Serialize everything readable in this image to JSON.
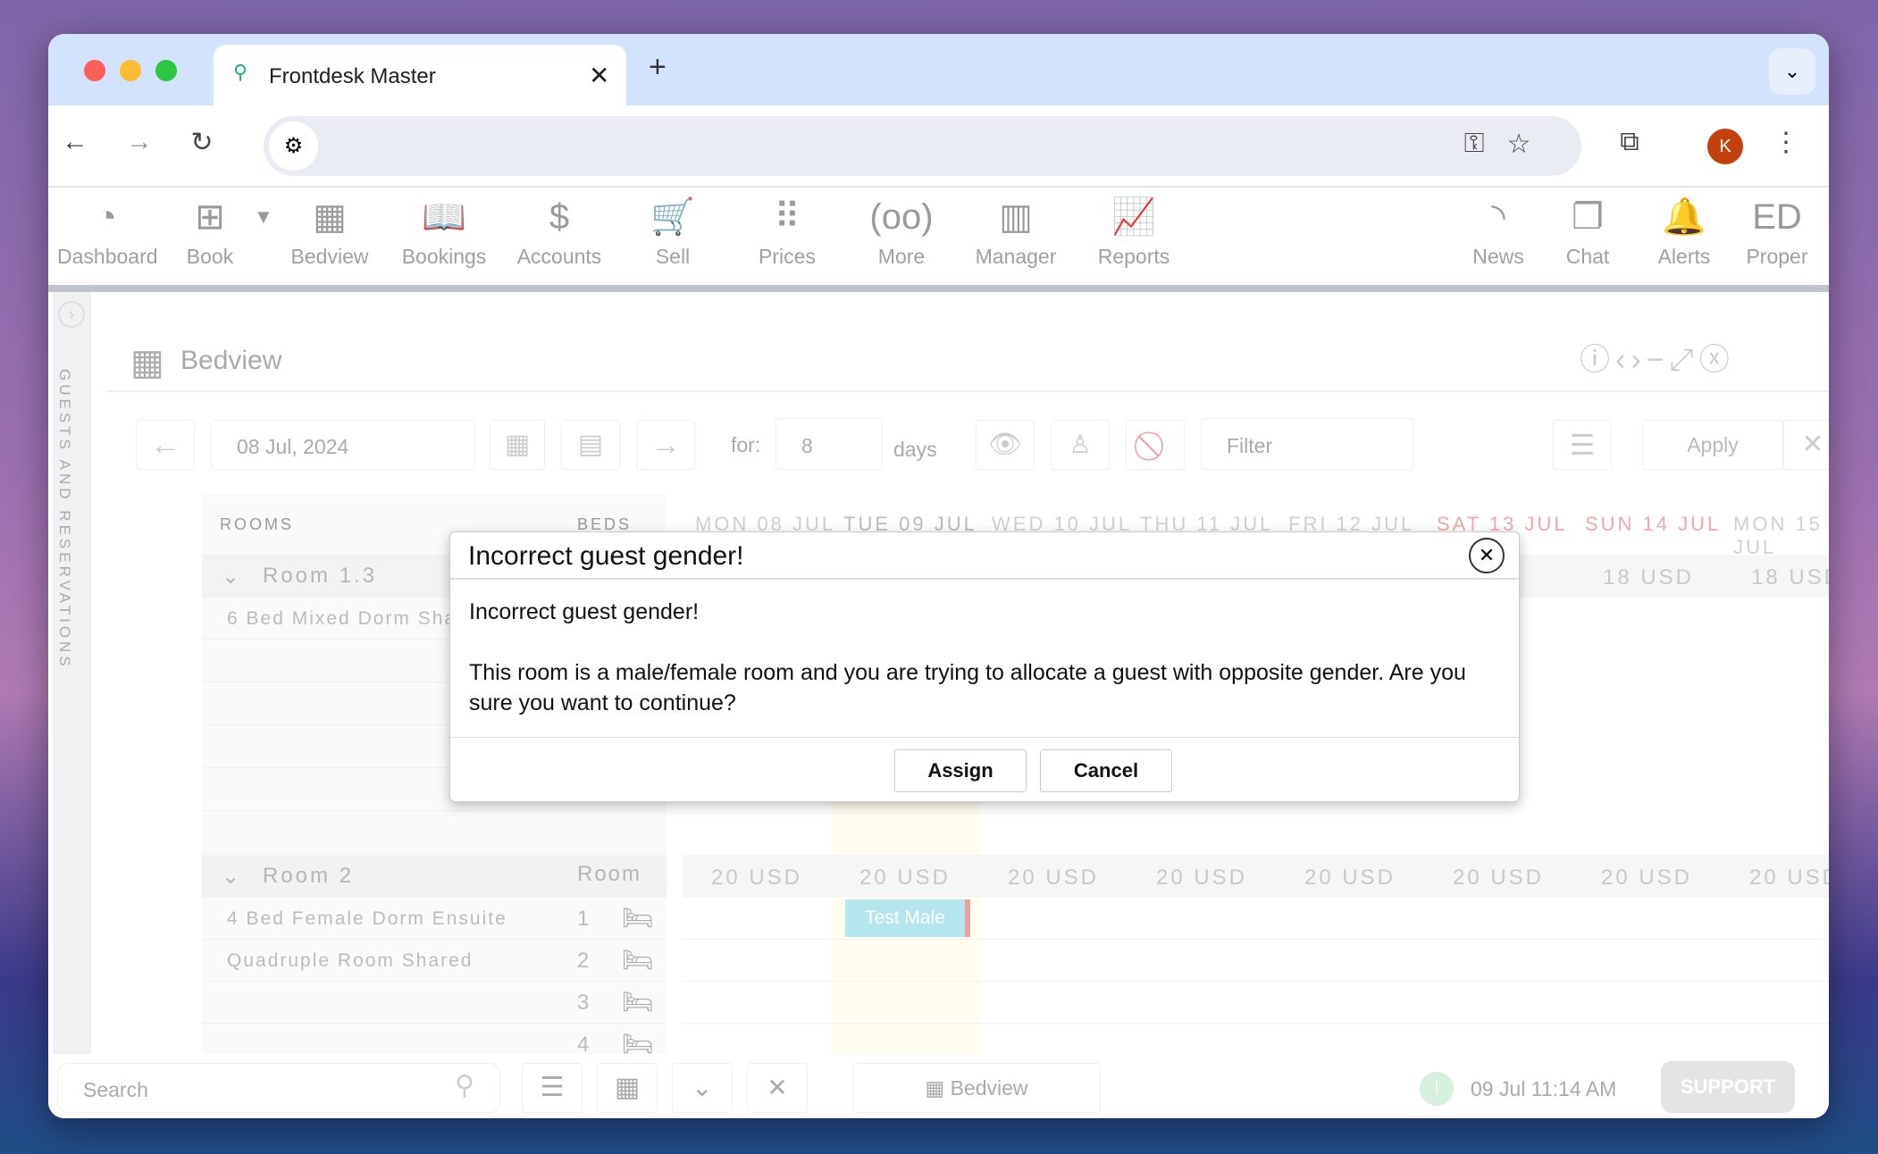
{
  "browser": {
    "tab_title": "Frontdesk Master",
    "profile_initial": "K",
    "icons": [
      "back-icon",
      "forward-icon",
      "reload-icon",
      "site-settings-icon",
      "key-icon",
      "star-icon",
      "extensions-icon",
      "menu-icon"
    ]
  },
  "nav": {
    "items": [
      {
        "label": "Dashboard",
        "icon": "◔"
      },
      {
        "label": "Book",
        "icon": "⊞"
      },
      {
        "label": "Bedview",
        "icon": "▦"
      },
      {
        "label": "Bookings",
        "icon": "📖"
      },
      {
        "label": "Accounts",
        "icon": "$"
      },
      {
        "label": "Sell",
        "icon": "🛒"
      },
      {
        "label": "Prices",
        "icon": "⠿"
      },
      {
        "label": "More",
        "icon": "(oo)"
      },
      {
        "label": "Manager",
        "icon": "▥"
      },
      {
        "label": "Reports",
        "icon": "📈"
      }
    ],
    "right_items": [
      {
        "label": "News",
        "icon": "◝"
      },
      {
        "label": "Chat",
        "icon": "❐"
      },
      {
        "label": "Alerts",
        "icon": "🔔"
      },
      {
        "label": "Proper",
        "icon": "ED"
      }
    ]
  },
  "sidebar": {
    "label": "GUESTS AND RESERVATIONS"
  },
  "panel": {
    "title": "Bedview"
  },
  "controls": {
    "date": "08 Jul, 2024",
    "for_label": "for:",
    "days_value": "8",
    "days_label": "days",
    "filter_placeholder": "Filter",
    "apply": "Apply"
  },
  "grid": {
    "rooms_header": "ROOMS",
    "beds_header": "BEDS",
    "dates": [
      {
        "label": "MON 08 JUL",
        "weekend": false
      },
      {
        "label": "TUE 09 JUL",
        "weekend": false
      },
      {
        "label": "WED 10 JUL",
        "weekend": false
      },
      {
        "label": "THU 11 JUL",
        "weekend": false
      },
      {
        "label": "FRI 12 JUL",
        "weekend": false
      },
      {
        "label": "SAT 13 JUL",
        "weekend": true
      },
      {
        "label": "SUN 14 JUL",
        "weekend": true
      },
      {
        "label": "MON 15 JUL",
        "weekend": false
      }
    ],
    "room1": {
      "name": "Room 1.3",
      "type": "6 Bed Mixed Dorm Shared",
      "prices_visible": [
        "18 USD",
        "18 USD"
      ]
    },
    "room2": {
      "name": "Room 2",
      "beds_label": "Room",
      "prices": [
        "20 USD",
        "20 USD",
        "20 USD",
        "20 USD",
        "20 USD",
        "20 USD",
        "20 USD",
        "20 USD"
      ],
      "beds": [
        {
          "type": "4 Bed Female Dorm Ensuite",
          "num": "1"
        },
        {
          "type": "Quadruple Room Shared",
          "num": "2"
        },
        {
          "type": "",
          "num": "3"
        },
        {
          "type": "",
          "num": "4"
        }
      ],
      "booking": "Test Male"
    }
  },
  "bottom": {
    "search_placeholder": "Search",
    "tab_label": "Bedview",
    "datetime": "09 Jul 11:14 AM",
    "support": "SUPPORT"
  },
  "dialog": {
    "title": "Incorrect guest gender!",
    "line1": "Incorrect guest gender!",
    "line2": "This room is a male/female room and you are trying to allocate a guest with opposite gender. Are you sure you want to continue?",
    "assign": "Assign",
    "cancel": "Cancel"
  },
  "colors": {
    "accent_red": "#e8a0a0",
    "booking": "#b5e6ee",
    "today_col": "#fffdf0",
    "avatar": "#c2410c"
  }
}
